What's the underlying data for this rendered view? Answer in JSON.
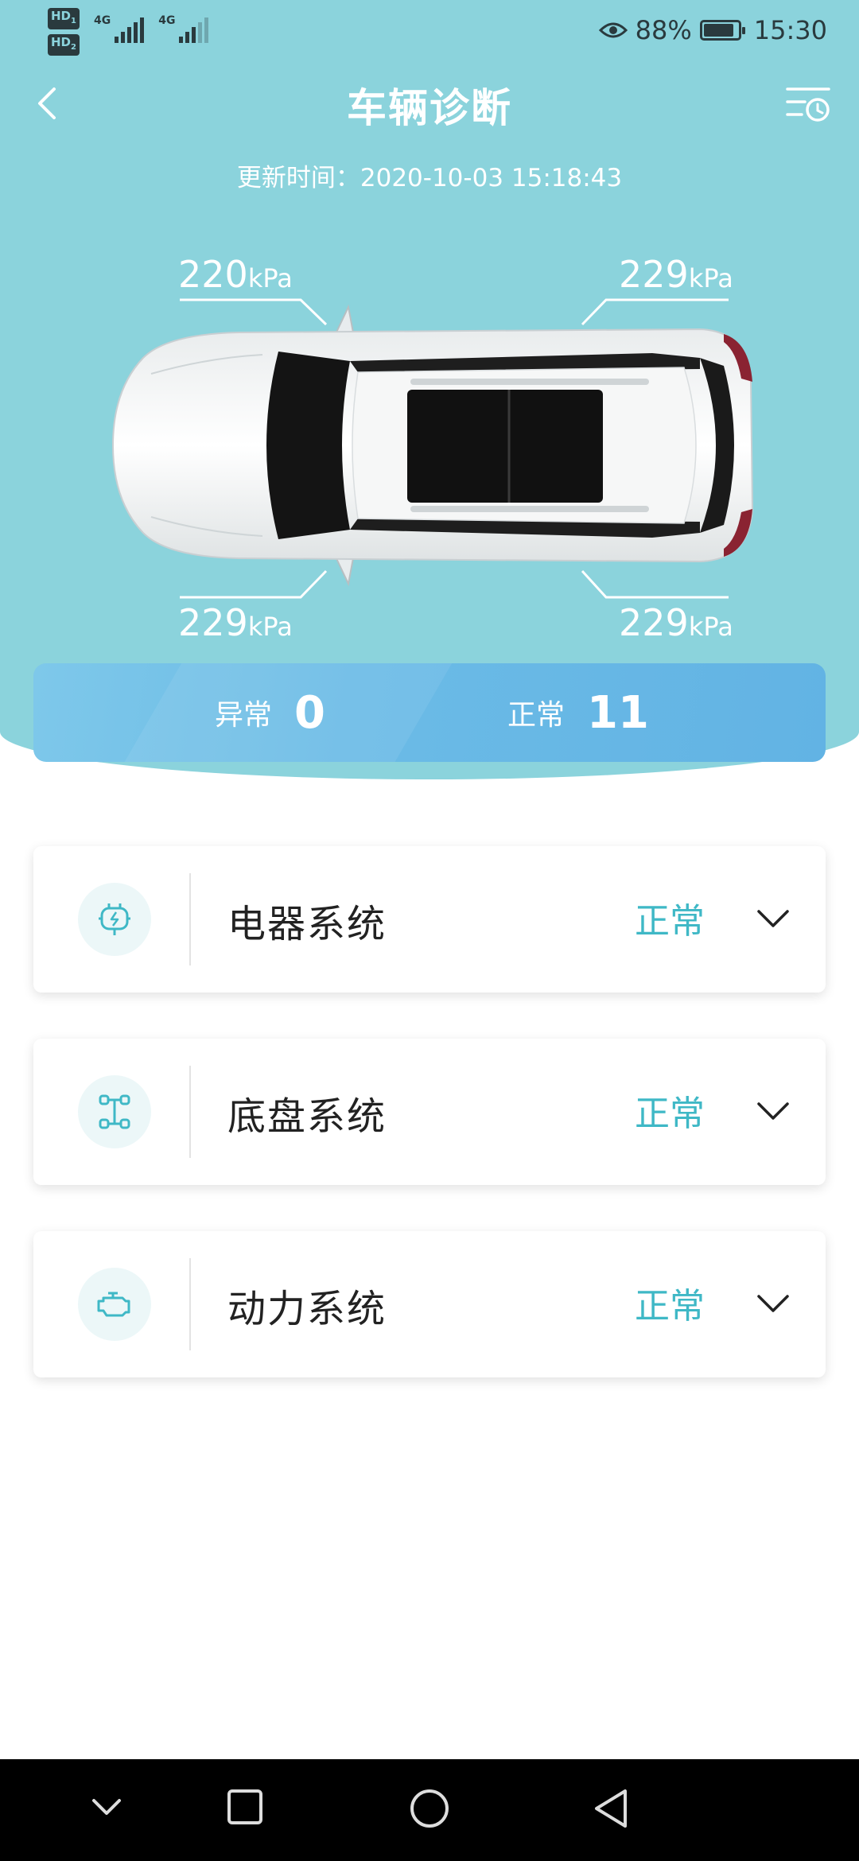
{
  "status_bar": {
    "hd1": "HD",
    "hd1_sub": "1",
    "hd2": "HD",
    "hd2_sub": "2",
    "net1": "4G",
    "net2": "4G",
    "battery_percent": "88%",
    "battery_level": 0.88,
    "time": "15:30"
  },
  "header": {
    "title": "车辆诊断",
    "update_time": "更新时间：2020-10-03 15:18:43"
  },
  "tires": {
    "front_left": {
      "value": "220",
      "unit": "kPa"
    },
    "front_right": {
      "value": "229",
      "unit": "kPa"
    },
    "rear_left": {
      "value": "229",
      "unit": "kPa"
    },
    "rear_right": {
      "value": "229",
      "unit": "kPa"
    }
  },
  "summary": {
    "abnormal_label": "异常",
    "abnormal_count": "0",
    "normal_label": "正常",
    "normal_count": "11"
  },
  "systems": [
    {
      "name": "电器系统",
      "status": "正常",
      "icon": "electric-plug-icon"
    },
    {
      "name": "底盘系统",
      "status": "正常",
      "icon": "chassis-icon"
    },
    {
      "name": "动力系统",
      "status": "正常",
      "icon": "engine-icon"
    }
  ],
  "colors": {
    "header_bg": "#8bd3dc",
    "status_ok": "#3fb8c6",
    "summary_bar": "#6bbbe6"
  }
}
